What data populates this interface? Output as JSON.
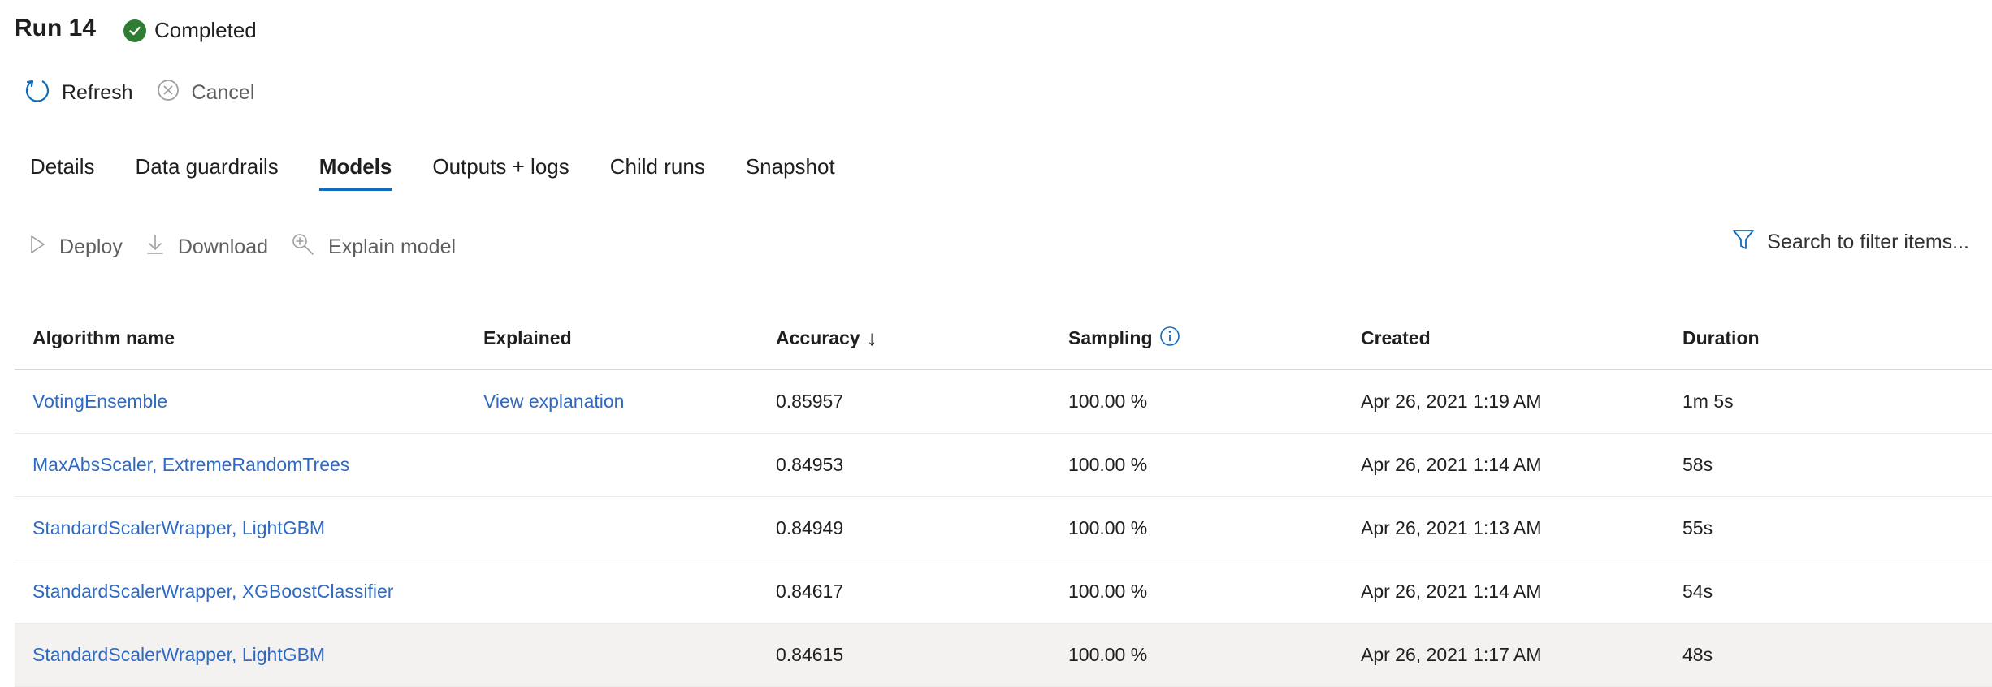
{
  "header": {
    "title": "Run 14",
    "status": "Completed"
  },
  "commands": {
    "refresh": "Refresh",
    "cancel": "Cancel"
  },
  "tabs": [
    {
      "label": "Details"
    },
    {
      "label": "Data guardrails"
    },
    {
      "label": "Models"
    },
    {
      "label": "Outputs + logs"
    },
    {
      "label": "Child runs"
    },
    {
      "label": "Snapshot"
    }
  ],
  "active_tab": "Models",
  "toolbar": {
    "deploy": "Deploy",
    "download": "Download",
    "explain": "Explain model",
    "filter_placeholder": "Search to filter items..."
  },
  "table": {
    "columns": {
      "algorithm": "Algorithm name",
      "explained": "Explained",
      "accuracy": "Accuracy",
      "sort_indicator": "↓",
      "sampling": "Sampling",
      "created": "Created",
      "duration": "Duration"
    },
    "rows": [
      {
        "algorithm": "VotingEnsemble",
        "explained": "View explanation",
        "accuracy": "0.85957",
        "sampling": "100.00 %",
        "created": "Apr 26, 2021 1:19 AM",
        "duration": "1m 5s"
      },
      {
        "algorithm": "MaxAbsScaler, ExtremeRandomTrees",
        "explained": "",
        "accuracy": "0.84953",
        "sampling": "100.00 %",
        "created": "Apr 26, 2021 1:14 AM",
        "duration": "58s"
      },
      {
        "algorithm": "StandardScalerWrapper, LightGBM",
        "explained": "",
        "accuracy": "0.84949",
        "sampling": "100.00 %",
        "created": "Apr 26, 2021 1:13 AM",
        "duration": "55s"
      },
      {
        "algorithm": "StandardScalerWrapper, XGBoostClassifier",
        "explained": "",
        "accuracy": "0.84617",
        "sampling": "100.00 %",
        "created": "Apr 26, 2021 1:14 AM",
        "duration": "54s"
      },
      {
        "algorithm": "StandardScalerWrapper, LightGBM",
        "explained": "",
        "accuracy": "0.84615",
        "sampling": "100.00 %",
        "created": "Apr 26, 2021 1:17 AM",
        "duration": "48s"
      }
    ]
  },
  "colors": {
    "link": "#2f6ac0",
    "accent": "#0f6cbd",
    "success": "#2e7d32"
  }
}
